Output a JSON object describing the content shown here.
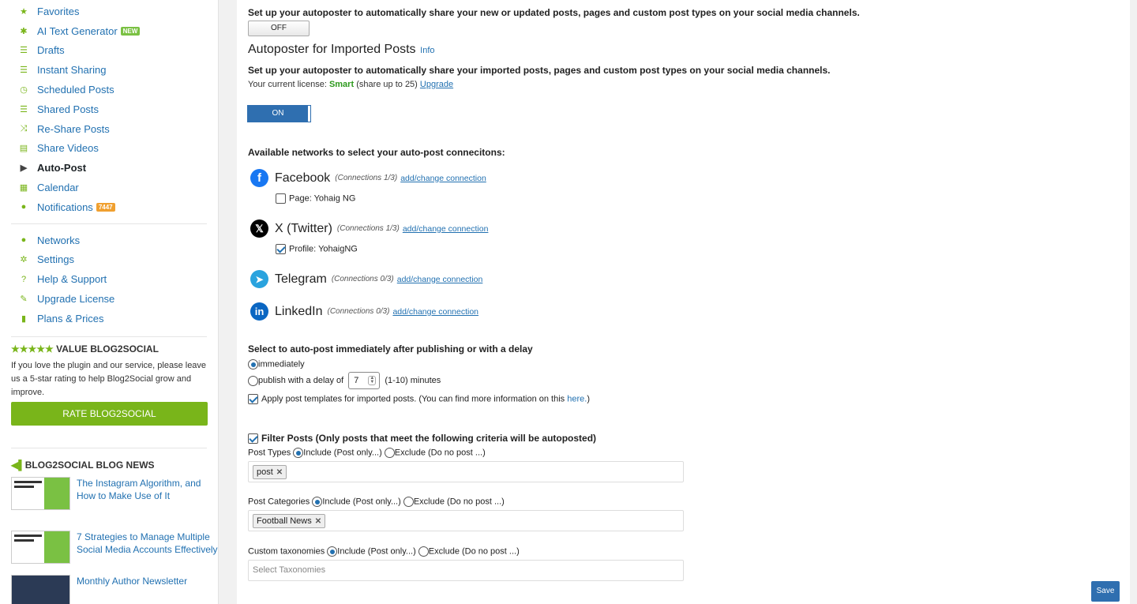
{
  "sidebar": {
    "nav": [
      {
        "label": "Favorites",
        "icon": "star-icon",
        "glyph": "★"
      },
      {
        "label": "AI Text Generator",
        "icon": "ai-icon",
        "glyph": "✱",
        "badge": "NEW"
      },
      {
        "label": "Drafts",
        "icon": "list-icon",
        "glyph": "☰"
      },
      {
        "label": "Instant Sharing",
        "icon": "list-icon",
        "glyph": "☰"
      },
      {
        "label": "Scheduled Posts",
        "icon": "clock-icon",
        "glyph": "◷"
      },
      {
        "label": "Shared Posts",
        "icon": "list-icon",
        "glyph": "☰"
      },
      {
        "label": "Re-Share Posts",
        "icon": "shuffle-icon",
        "glyph": "⤨"
      },
      {
        "label": "Share Videos",
        "icon": "film-icon",
        "glyph": "▤"
      },
      {
        "label": "Auto-Post",
        "icon": "play-icon",
        "glyph": "▶",
        "active": true
      },
      {
        "label": "Calendar",
        "icon": "calendar-icon",
        "glyph": "▦"
      },
      {
        "label": "Notifications",
        "icon": "alert-icon",
        "glyph": "●",
        "count": "7447"
      }
    ],
    "nav2": [
      {
        "label": "Networks",
        "icon": "user-icon",
        "glyph": "●"
      },
      {
        "label": "Settings",
        "icon": "gear-icon",
        "glyph": "✲"
      },
      {
        "label": "Help & Support",
        "icon": "help-icon",
        "glyph": "?"
      },
      {
        "label": "Upgrade License",
        "icon": "pencil-icon",
        "glyph": "✎"
      },
      {
        "label": "Plans & Prices",
        "icon": "bars-icon",
        "glyph": "▮"
      }
    ],
    "value": {
      "stars": "★★★★★",
      "title": "VALUE BLOG2SOCIAL",
      "text": "If you love the plugin and our service, please leave us a 5-star rating to help Blog2Social grow and improve.",
      "button": "RATE BLOG2SOCIAL"
    },
    "news": {
      "title": "BLOG2SOCIAL BLOG NEWS",
      "items": [
        {
          "title": "The Instagram Algorithm, and How to Make Use of It"
        },
        {
          "title": "7 Strategies to Manage Multiple Social Media Accounts Effectively"
        },
        {
          "title": "Monthly Author Newsletter"
        }
      ]
    }
  },
  "main": {
    "intro_text": "Set up your autoposter to automatically share your new or updated posts, pages and custom post types on your social media channels.",
    "toggle_off": "OFF",
    "imported_title": "Autoposter for Imported Posts",
    "info_link": "Info",
    "imported_text": "Set up your autoposter to automatically share your imported posts, pages and custom post types on your social media channels.",
    "license_label": "Your current license:",
    "license_name": "Smart",
    "license_suffix": "(share up to 25)",
    "upgrade_link": "Upgrade",
    "toggle_on": "ON",
    "networks_title": "Available networks to select your auto-post connecitons:",
    "networks": [
      {
        "name": "Facebook",
        "conn": "(Connections 1/3)",
        "link": "add/change connection",
        "sub": "Page: Yohaig NG",
        "checked": false,
        "color": "#1877f2"
      },
      {
        "name": "X (Twitter)",
        "conn": "(Connections 1/3)",
        "link": "add/change connection",
        "sub": "Profile: YohaigNG",
        "checked": true,
        "color": "#000000"
      },
      {
        "name": "Telegram",
        "conn": "(Connections 0/3)",
        "link": "add/change connection",
        "color": "#2aa3de"
      },
      {
        "name": "LinkedIn",
        "conn": "(Connections 0/3)",
        "link": "add/change connection",
        "color": "#0a66c2"
      }
    ],
    "delay_title": "Select to auto-post immediately after publishing or with a delay",
    "opt_immediately": "immediately",
    "opt_delay": "publish with a delay of",
    "delay_value": "7",
    "delay_suffix": "(1-10) minutes",
    "templates_text": "Apply post templates for imported posts. (You can find more information on this",
    "templates_link": "here.",
    "templates_end": ")",
    "filter_title": "Filter Posts (Only posts that meet the following criteria will be autoposted)",
    "include_label": "Include (Post only...)",
    "exclude_label": "Exclude (Do no post ...)",
    "post_types_label": "Post Types",
    "post_types_tag": "post",
    "post_categories_label": "Post Categories",
    "post_categories_tag": "Football News",
    "custom_tax_label": "Custom taxonomies",
    "custom_tax_placeholder": "Select Taxonomies",
    "save": "Save"
  }
}
